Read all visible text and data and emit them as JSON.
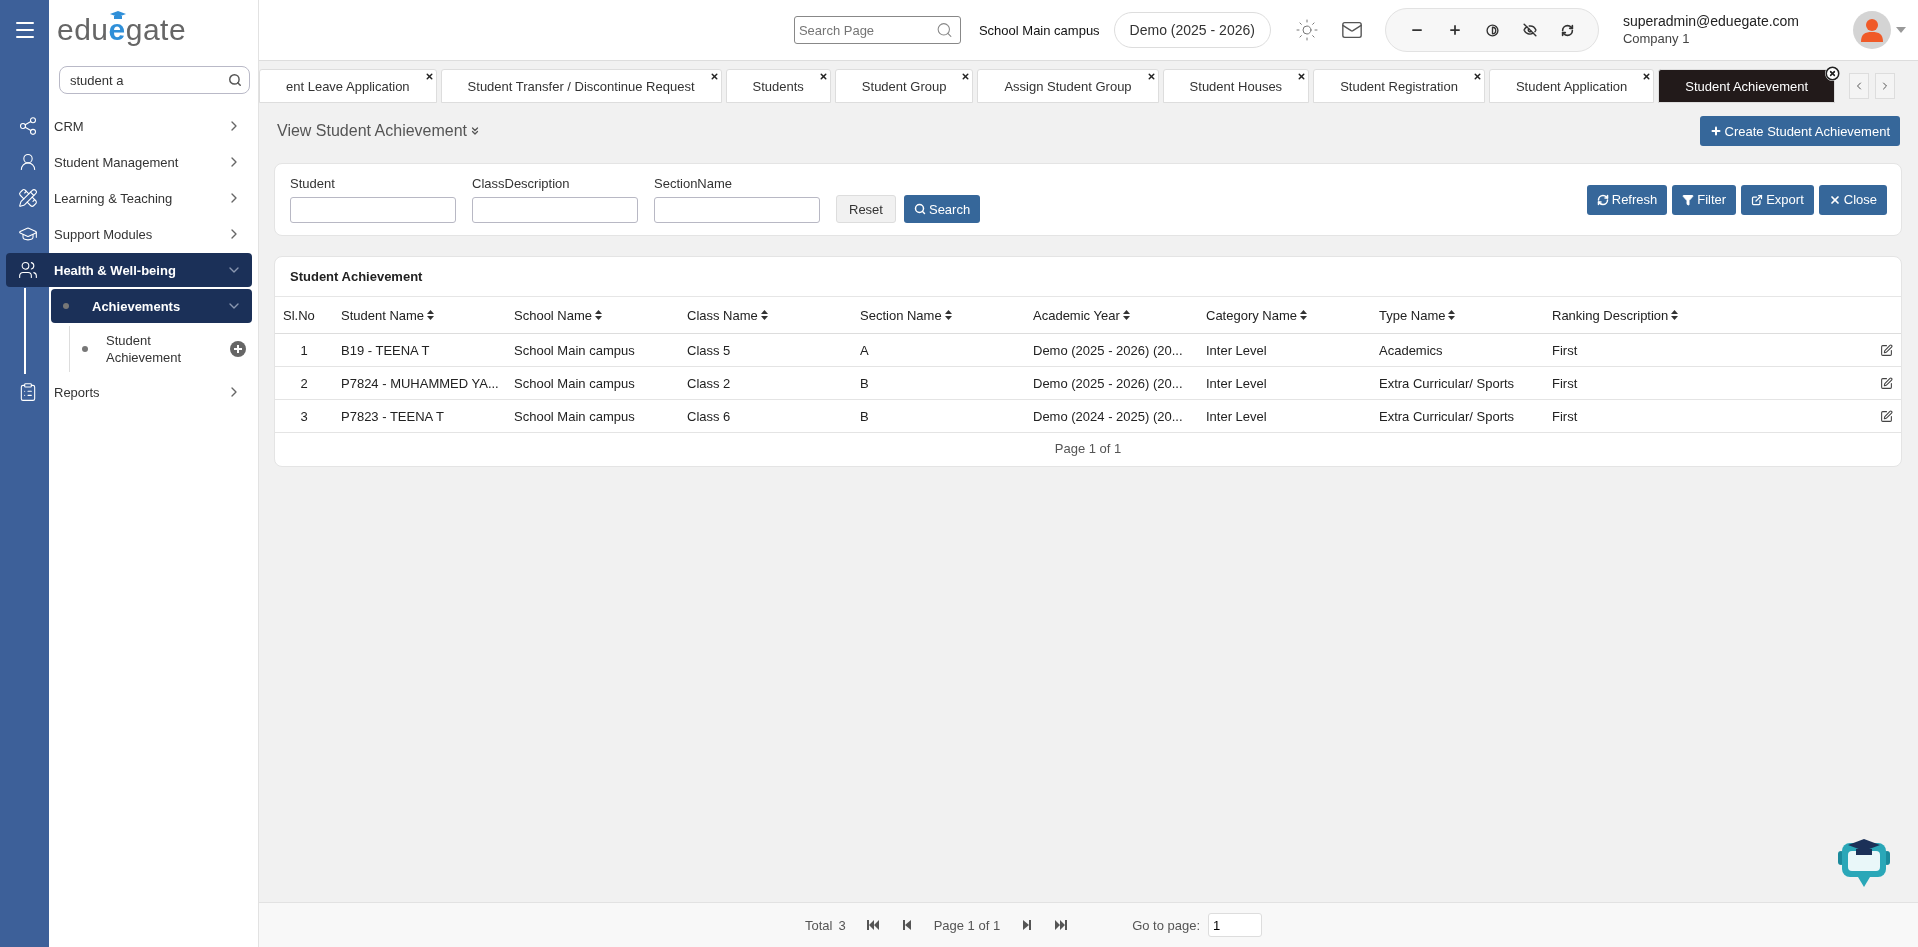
{
  "sidebar": {
    "logo": {
      "before": "edu",
      "mark": "e",
      "after": "gate"
    },
    "search": {
      "value": "student a"
    },
    "menu": [
      {
        "kind": "network",
        "label": "CRM",
        "expanded": false,
        "selected": false
      },
      {
        "kind": "student",
        "label": "Student Management",
        "expanded": false,
        "selected": false
      },
      {
        "kind": "teaching",
        "label": "Learning & Teaching",
        "expanded": false,
        "selected": false
      },
      {
        "kind": "cap",
        "label": "Support Modules",
        "expanded": false,
        "selected": false
      },
      {
        "kind": "health",
        "label": "Health & Well-being",
        "expanded": true,
        "selected": true,
        "children": [
          {
            "label": "Achievements",
            "expanded": true,
            "selected": true,
            "children": [
              {
                "label": "Student Achievement"
              }
            ]
          }
        ]
      },
      {
        "kind": "report",
        "label": "Reports",
        "expanded": false,
        "selected": false
      }
    ]
  },
  "header": {
    "search": {
      "placeholder": "Search Page"
    },
    "campus": "School Main campus",
    "year": "Demo (2025 - 2026)",
    "user": {
      "email": "superadmin@eduegate.com",
      "company": "Company 1"
    }
  },
  "tabs": [
    {
      "label": "ent Leave Application",
      "selected": false
    },
    {
      "label": "Student Transfer / Discontinue Request",
      "selected": false
    },
    {
      "label": "Students",
      "selected": false
    },
    {
      "label": "Student Group",
      "selected": false
    },
    {
      "label": "Assign Student Group",
      "selected": false
    },
    {
      "label": "Student Houses",
      "selected": false
    },
    {
      "label": "Student Registration",
      "selected": false
    },
    {
      "label": "Student Application",
      "selected": false
    },
    {
      "label": "Student Achievement",
      "selected": true
    }
  ],
  "page": {
    "title": "View Student Achievement",
    "create_button": "Create Student Achievement"
  },
  "filters": {
    "fields": [
      {
        "label": "Student"
      },
      {
        "label": "ClassDescription"
      },
      {
        "label": "SectionName"
      }
    ],
    "reset": "Reset",
    "search": "Search",
    "actions": [
      {
        "kind": "refresh",
        "label": "Refresh"
      },
      {
        "kind": "filter",
        "label": "Filter"
      },
      {
        "kind": "export",
        "label": "Export"
      },
      {
        "kind": "close",
        "label": "Close"
      }
    ]
  },
  "table": {
    "title": "Student Achievement",
    "columns": [
      {
        "label": "Sl.No",
        "sortable": false
      },
      {
        "label": "Student Name",
        "sortable": true
      },
      {
        "label": "School Name",
        "sortable": true
      },
      {
        "label": "Class Name",
        "sortable": true
      },
      {
        "label": "Section Name",
        "sortable": true
      },
      {
        "label": "Academic Year",
        "sortable": true
      },
      {
        "label": "Category Name",
        "sortable": true
      },
      {
        "label": "Type Name",
        "sortable": true
      },
      {
        "label": "Ranking Description",
        "sortable": true
      }
    ],
    "rows": [
      [
        "1",
        "B19 - TEENA T",
        "School Main campus",
        "Class 5",
        "A",
        "Demo (2025 - 2026) (20...",
        "Inter Level",
        "Academics",
        "First"
      ],
      [
        "2",
        "P7824 - MUHAMMED YA...",
        "School Main campus",
        "Class 2",
        "B",
        "Demo (2025 - 2026) (20...",
        "Inter Level",
        "Extra Curricular/ Sports",
        "First"
      ],
      [
        "3",
        "P7823 - TEENA T",
        "School Main campus",
        "Class 6",
        "B",
        "Demo (2024 - 2025) (20...",
        "Inter Level",
        "Extra Curricular/ Sports",
        "First"
      ]
    ],
    "footer": "Page 1 of 1"
  },
  "pager": {
    "total_label": "Total",
    "total": "3",
    "page": "Page 1 of 1",
    "goto_label": "Go to page:",
    "goto_value": "1"
  }
}
